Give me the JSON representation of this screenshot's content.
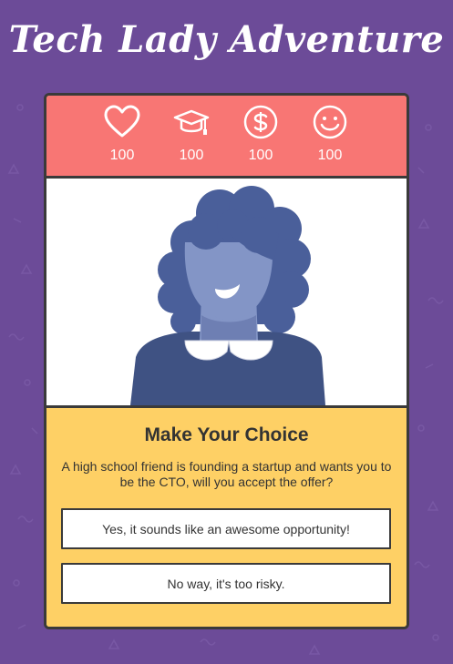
{
  "game": {
    "title": "Tech Lady Adventure"
  },
  "stats": [
    {
      "icon": "heart-icon",
      "value": "100"
    },
    {
      "icon": "graduation-cap-icon",
      "value": "100"
    },
    {
      "icon": "dollar-icon",
      "value": "100"
    },
    {
      "icon": "smiley-icon",
      "value": "100"
    }
  ],
  "choice": {
    "heading": "Make Your Choice",
    "prompt": "A high school friend is founding a startup and wants you to be the CTO, will you accept the offer?",
    "options": [
      "Yes, it sounds like an awesome opportunity!",
      "No way, it's too risky."
    ]
  },
  "colors": {
    "background": "#6c4b98",
    "stats_bar": "#f87674",
    "choice_panel": "#fed065",
    "portrait_hair": "#4a5f9a",
    "portrait_skin": "#8395c6",
    "portrait_shirt": "#3f5283",
    "border": "#3a3a3a"
  }
}
